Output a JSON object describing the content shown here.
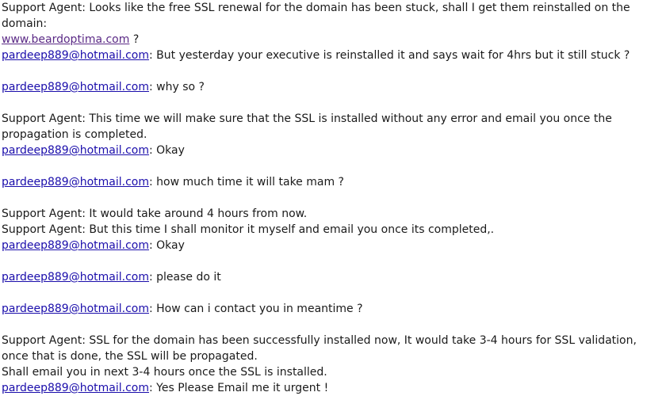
{
  "transcript": {
    "agent_prefix": "Support Agent:",
    "customer_email": "pardeep889@hotmail.com",
    "m1": {
      "text": " Looks like the free SSL renewal for the domain has been stuck, shall I get them reinstalled on the domain:",
      "link": "www.beardoptima.com",
      "suffix": " ?"
    },
    "m2": ": But yesterday your executive is reinstalled it and says wait for 4hrs but it still stuck ?",
    "m3": ": why so ?",
    "m4": " This time we will make sure that the SSL is installed without any error and email you once the propagation is completed.",
    "m5": ": Okay",
    "m6": ": how much time it will take mam ?",
    "m7": " It would take around 4 hours from now.",
    "m8": " But this time I shall monitor it myself and email you once its completed,.",
    "m9": ": Okay",
    "m10": ": please do it",
    "m11": ": How can i contact you in meantime ?",
    "m12": {
      "line1": " SSL for the domain has been successfully installed now, It would take 3-4 hours for SSL validation,",
      "line2": "once that is done, the SSL will be propagated.",
      "line3": "Shall email you in next 3-4 hours once the SSL is installed."
    },
    "m13": ": Yes Please Email me it urgent !"
  }
}
